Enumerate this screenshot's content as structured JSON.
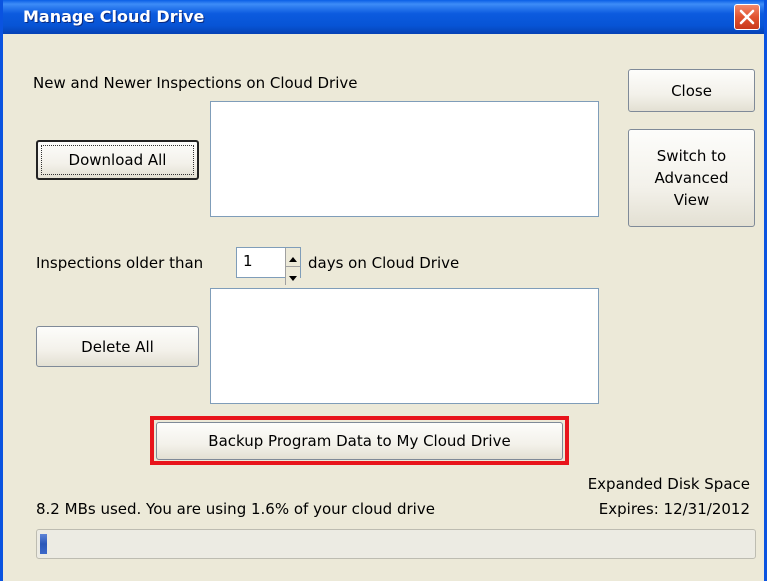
{
  "window": {
    "title": "Manage Cloud Drive"
  },
  "new_section": {
    "label": "New and Newer Inspections on Cloud Drive",
    "download_all_label": "Download All"
  },
  "older_section": {
    "prefix": "Inspections older than",
    "days_value": "1",
    "suffix": "days on Cloud Drive",
    "delete_all_label": "Delete All"
  },
  "side_buttons": {
    "close_label": "Close",
    "advanced_label": "Switch to\nAdvanced\nView"
  },
  "backup": {
    "label": "Backup Program Data to My Cloud Drive",
    "highlight_color": "#e8141b"
  },
  "usage": {
    "text": "8.2 MBs used. You are using  1.6% of your cloud drive",
    "percent_used": 1.6,
    "expanded_line1": "Expanded Disk Space",
    "expanded_line2": "Expires: 12/31/2012"
  },
  "icons": {
    "close": "close-icon",
    "spin_up": "spin-up-icon",
    "spin_down": "spin-down-icon"
  }
}
